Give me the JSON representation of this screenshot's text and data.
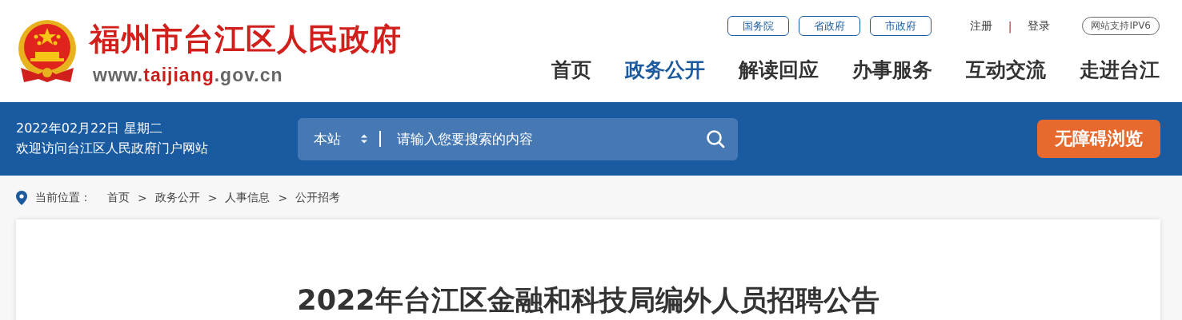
{
  "site": {
    "title": "福州市台江区人民政府",
    "url_prefix": "www.",
    "url_domain": "taijiang",
    "url_suffix": ".gov.cn"
  },
  "top_links": [
    {
      "label": "国务院"
    },
    {
      "label": "省政府"
    },
    {
      "label": "市政府"
    }
  ],
  "account": {
    "register": "注册",
    "separator": "|",
    "login": "登录"
  },
  "ipv6_badge": "网站支持IPV6",
  "nav": [
    {
      "label": "首页",
      "selected": false
    },
    {
      "label": "政务公开",
      "selected": true
    },
    {
      "label": "解读回应",
      "selected": false
    },
    {
      "label": "办事服务",
      "selected": false
    },
    {
      "label": "互动交流",
      "selected": false
    },
    {
      "label": "走进台江",
      "selected": false
    }
  ],
  "banner": {
    "date": "2022年02月22日 星期二",
    "welcome": "欢迎访问台江区人民政府门户网站",
    "search_scope": "本站",
    "search_placeholder": "请输入您要搜索的内容",
    "accessibility_button": "无障碍浏览"
  },
  "breadcrumb": {
    "label": "当前位置：",
    "separator": ">",
    "items": [
      "首页",
      "政务公开",
      "人事信息",
      "公开招考"
    ]
  },
  "article": {
    "title": "2022年台江区金融和科技局编外人员招聘公告"
  }
}
